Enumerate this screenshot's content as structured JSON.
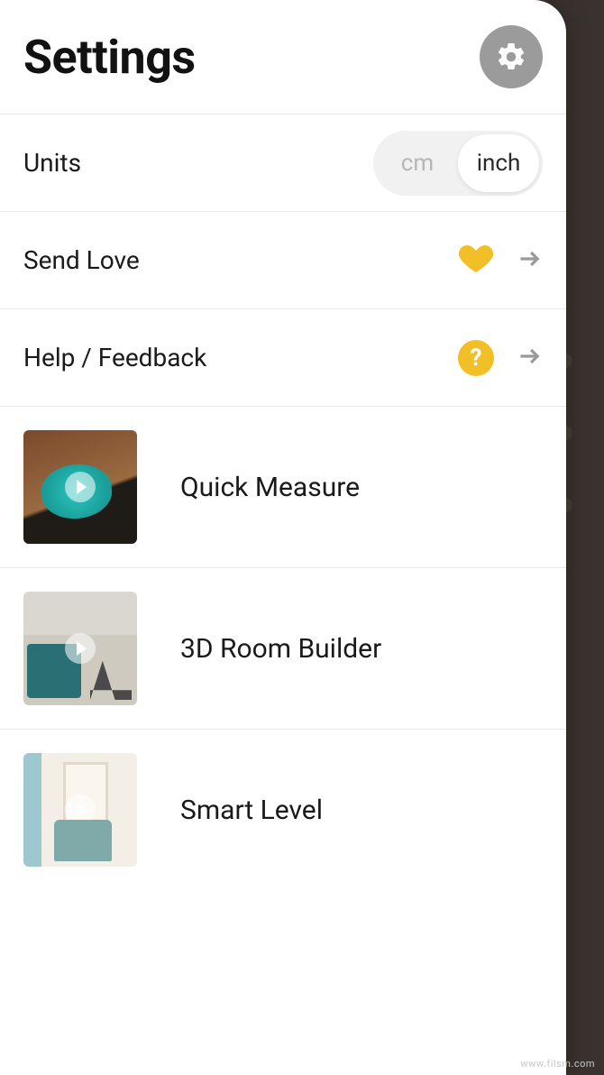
{
  "header": {
    "title": "Settings"
  },
  "rows": {
    "units": {
      "label": "Units",
      "options": {
        "cm": "cm",
        "inch": "inch"
      },
      "selected": "inch"
    },
    "love": {
      "label": "Send Love"
    },
    "help": {
      "label": "Help / Feedback",
      "glyph": "?"
    }
  },
  "tutorials": [
    {
      "label": "Quick Measure"
    },
    {
      "label": "3D Room Builder"
    },
    {
      "label": "Smart Level"
    }
  ],
  "watermark": "www.filsm.com"
}
